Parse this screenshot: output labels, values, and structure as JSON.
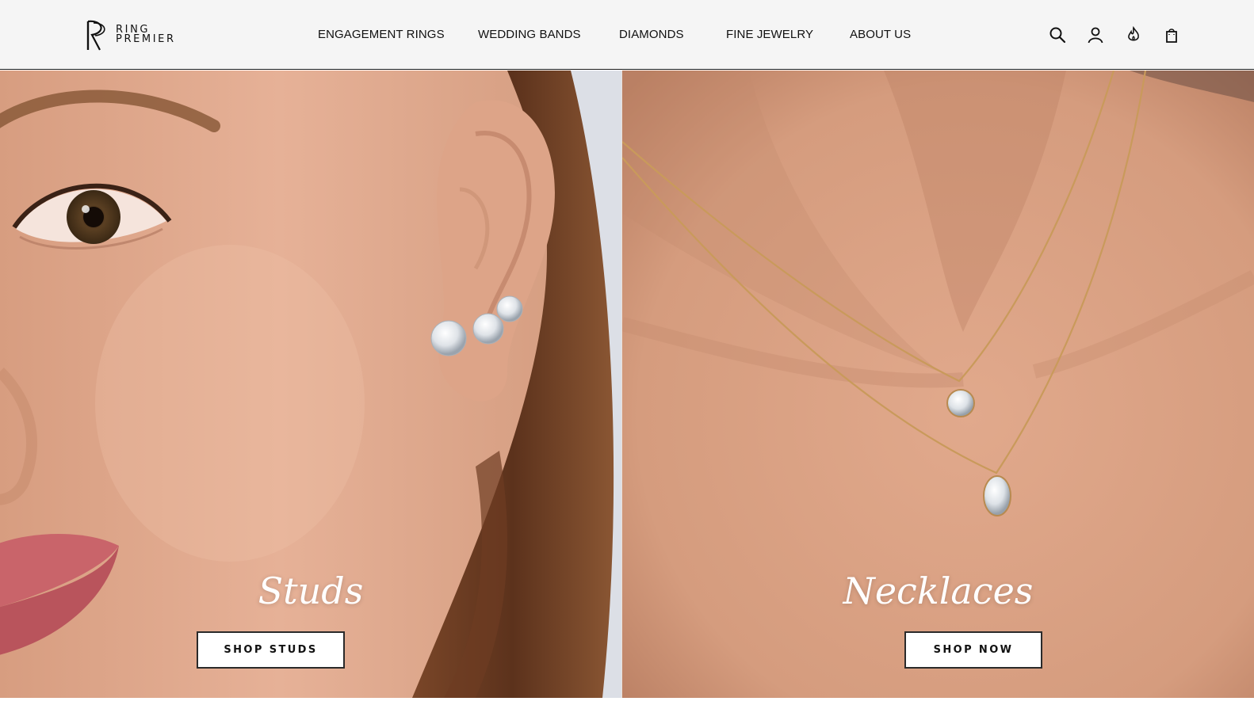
{
  "brand": {
    "line1": "RING",
    "line2": "PREMIER"
  },
  "nav": {
    "items": [
      {
        "label": "ENGAGEMENT RINGS"
      },
      {
        "label": "WEDDING BANDS"
      },
      {
        "label": "DIAMONDS"
      },
      {
        "label": "FINE JEWELRY"
      },
      {
        "label": "ABOUT US"
      }
    ]
  },
  "header_icons": [
    "search-icon",
    "account-icon",
    "flame-icon",
    "shopping-bag-icon"
  ],
  "panels": {
    "left": {
      "title": "Studs",
      "button_label": "SHOP STUDS"
    },
    "right": {
      "title": "Necklaces",
      "button_label": "SHOP NOW"
    }
  },
  "colors": {
    "header_bg": "#f5f5f5",
    "text": "#111111",
    "skin_light": "#e8b9a0",
    "hair": "#6b3f25",
    "gold": "#c99a5b"
  }
}
